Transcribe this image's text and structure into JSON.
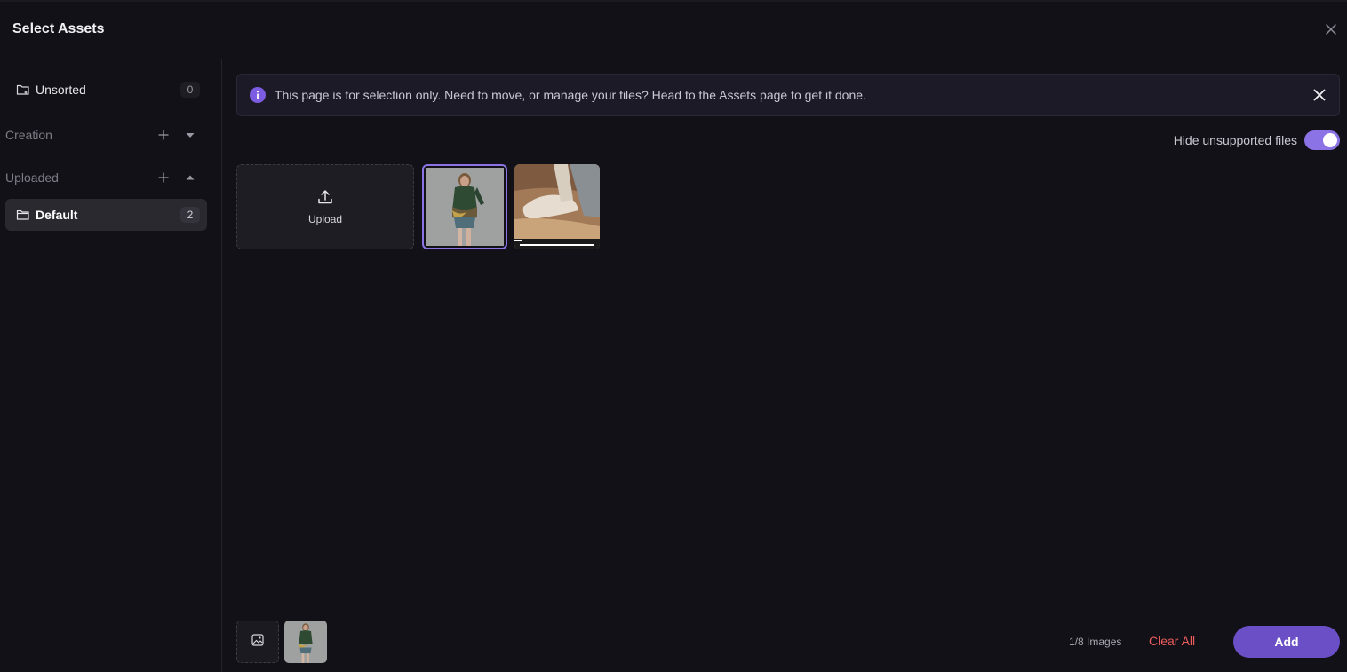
{
  "header": {
    "title": "Select Assets",
    "close_icon": "close-icon"
  },
  "sidebar": {
    "unsorted": {
      "label": "Unsorted",
      "count": "0",
      "icon": "folder-icon"
    },
    "sections": [
      {
        "label": "Creation",
        "expanded": false
      },
      {
        "label": "Uploaded",
        "expanded": true
      }
    ],
    "folders": [
      {
        "label": "Default",
        "count": "2",
        "active": true,
        "icon": "folder-icon"
      }
    ]
  },
  "main": {
    "banner": {
      "message": "This page is for selection only. Need to move, or manage your files? Head to the Assets page to get it done.",
      "icon": "info-icon",
      "accent": "#7c5ce0"
    },
    "toggle": {
      "label": "Hide unsupported files",
      "on": true,
      "color": "#8b73e6"
    },
    "upload": {
      "label": "Upload",
      "icon": "upload-icon"
    },
    "assets": [
      {
        "name": "woman-green-sweater",
        "selected": true
      },
      {
        "name": "socks-closeup",
        "selected": false
      }
    ]
  },
  "footer": {
    "image_count": "1/8 Images",
    "clear_label": "Clear All",
    "add_label": "Add",
    "clear_color": "#ef5d5d",
    "add_color": "#6b4fc6"
  }
}
